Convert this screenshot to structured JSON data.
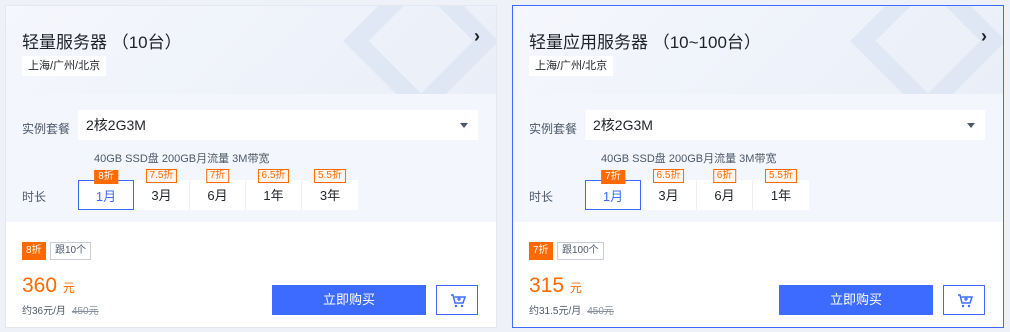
{
  "colors": {
    "accent": "#3d6bff",
    "discount": "#ff6a00",
    "text": "#1f2329",
    "muted": "#4e5969"
  },
  "cards": [
    {
      "title": "轻量服务器 （10台）",
      "region": "上海/广州/北京",
      "arrow_icon": "chevron-right-icon",
      "package_label": "实例套餐",
      "package_value": "2核2G3M",
      "spec": "40GB SSD盘 200GB月流量 3M带宽",
      "duration_label": "时长",
      "durations": [
        {
          "label": "1月",
          "discount": "8折",
          "active": true
        },
        {
          "label": "3月",
          "discount": "7.5折",
          "active": false
        },
        {
          "label": "6月",
          "discount": "7折",
          "active": false
        },
        {
          "label": "1年",
          "discount": "6.5折",
          "active": false
        },
        {
          "label": "3年",
          "discount": "5.5折",
          "active": false
        }
      ],
      "discount_tag": "8折",
      "limit_tag": "跟10个",
      "price": "360",
      "price_unit": "元",
      "per_month": "约36元/月",
      "original": "450元",
      "buy_label": "立即购买",
      "cart_icon": "cart-add-icon"
    },
    {
      "title": "轻量应用服务器 （10~100台）",
      "region": "上海/广州/北京",
      "arrow_icon": "chevron-right-icon",
      "package_label": "实例套餐",
      "package_value": "2核2G3M",
      "spec": "40GB SSD盘 200GB月流量 3M带宽",
      "duration_label": "时长",
      "durations": [
        {
          "label": "1月",
          "discount": "7折",
          "active": true
        },
        {
          "label": "3月",
          "discount": "6.5折",
          "active": false
        },
        {
          "label": "6月",
          "discount": "6折",
          "active": false
        },
        {
          "label": "1年",
          "discount": "5.5折",
          "active": false
        }
      ],
      "discount_tag": "7折",
      "limit_tag": "跟100个",
      "price": "315",
      "price_unit": "元",
      "per_month": "约31.5元/月",
      "original": "450元",
      "buy_label": "立即购买",
      "cart_icon": "cart-add-icon"
    }
  ]
}
